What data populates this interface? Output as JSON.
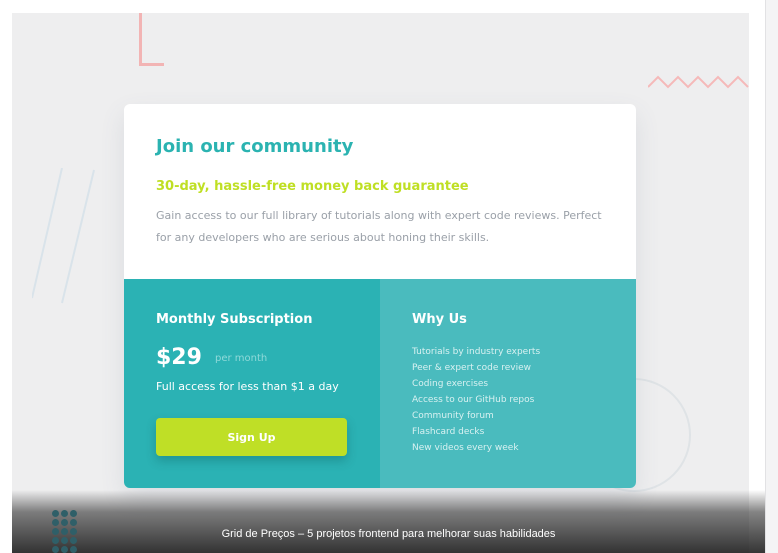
{
  "card": {
    "title": "Join our community",
    "subtitle": "30-day, hassle-free money back guarantee",
    "description": "Gain access to our full library of tutorials along with expert code reviews. Perfect for any developers who are serious about honing their skills."
  },
  "monthly": {
    "heading": "Monthly Subscription",
    "price": "$29",
    "period": "per month",
    "description": "Full access for less than $1 a day",
    "button_label": "Sign Up"
  },
  "why_us": {
    "heading": "Why Us",
    "items": [
      "Tutorials by industry experts",
      "Peer & expert code review",
      "Coding exercises",
      "Access to our GitHub repos",
      "Community forum",
      "Flashcard decks",
      "New videos every week"
    ]
  },
  "caption": "Grid de Preços – 5 projetos frontend para melhorar suas habilidades",
  "colors": {
    "accent_teal": "#2bb3b1",
    "accent_lime": "#bfdf24",
    "panel_dark": "#2bb2b4",
    "panel_light": "#4abbbe"
  }
}
